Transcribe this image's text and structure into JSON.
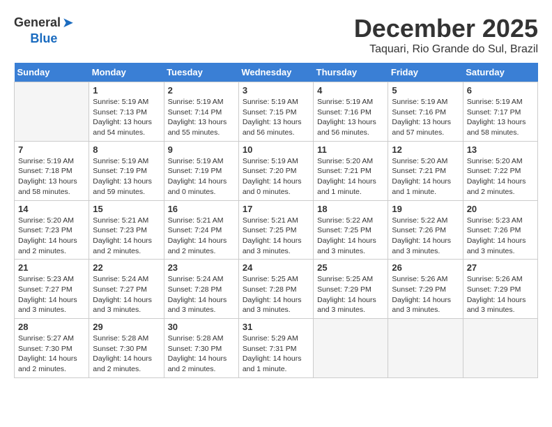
{
  "header": {
    "logo_general": "General",
    "logo_blue": "Blue",
    "month": "December 2025",
    "location": "Taquari, Rio Grande do Sul, Brazil"
  },
  "days_of_week": [
    "Sunday",
    "Monday",
    "Tuesday",
    "Wednesday",
    "Thursday",
    "Friday",
    "Saturday"
  ],
  "weeks": [
    [
      {
        "day": "",
        "empty": true
      },
      {
        "day": "1",
        "sunrise": "Sunrise: 5:19 AM",
        "sunset": "Sunset: 7:13 PM",
        "daylight": "Daylight: 13 hours and 54 minutes."
      },
      {
        "day": "2",
        "sunrise": "Sunrise: 5:19 AM",
        "sunset": "Sunset: 7:14 PM",
        "daylight": "Daylight: 13 hours and 55 minutes."
      },
      {
        "day": "3",
        "sunrise": "Sunrise: 5:19 AM",
        "sunset": "Sunset: 7:15 PM",
        "daylight": "Daylight: 13 hours and 56 minutes."
      },
      {
        "day": "4",
        "sunrise": "Sunrise: 5:19 AM",
        "sunset": "Sunset: 7:16 PM",
        "daylight": "Daylight: 13 hours and 56 minutes."
      },
      {
        "day": "5",
        "sunrise": "Sunrise: 5:19 AM",
        "sunset": "Sunset: 7:16 PM",
        "daylight": "Daylight: 13 hours and 57 minutes."
      },
      {
        "day": "6",
        "sunrise": "Sunrise: 5:19 AM",
        "sunset": "Sunset: 7:17 PM",
        "daylight": "Daylight: 13 hours and 58 minutes."
      }
    ],
    [
      {
        "day": "7",
        "sunrise": "Sunrise: 5:19 AM",
        "sunset": "Sunset: 7:18 PM",
        "daylight": "Daylight: 13 hours and 58 minutes."
      },
      {
        "day": "8",
        "sunrise": "Sunrise: 5:19 AM",
        "sunset": "Sunset: 7:19 PM",
        "daylight": "Daylight: 13 hours and 59 minutes."
      },
      {
        "day": "9",
        "sunrise": "Sunrise: 5:19 AM",
        "sunset": "Sunset: 7:19 PM",
        "daylight": "Daylight: 14 hours and 0 minutes."
      },
      {
        "day": "10",
        "sunrise": "Sunrise: 5:19 AM",
        "sunset": "Sunset: 7:20 PM",
        "daylight": "Daylight: 14 hours and 0 minutes."
      },
      {
        "day": "11",
        "sunrise": "Sunrise: 5:20 AM",
        "sunset": "Sunset: 7:21 PM",
        "daylight": "Daylight: 14 hours and 1 minute."
      },
      {
        "day": "12",
        "sunrise": "Sunrise: 5:20 AM",
        "sunset": "Sunset: 7:21 PM",
        "daylight": "Daylight: 14 hours and 1 minute."
      },
      {
        "day": "13",
        "sunrise": "Sunrise: 5:20 AM",
        "sunset": "Sunset: 7:22 PM",
        "daylight": "Daylight: 14 hours and 2 minutes."
      }
    ],
    [
      {
        "day": "14",
        "sunrise": "Sunrise: 5:20 AM",
        "sunset": "Sunset: 7:23 PM",
        "daylight": "Daylight: 14 hours and 2 minutes."
      },
      {
        "day": "15",
        "sunrise": "Sunrise: 5:21 AM",
        "sunset": "Sunset: 7:23 PM",
        "daylight": "Daylight: 14 hours and 2 minutes."
      },
      {
        "day": "16",
        "sunrise": "Sunrise: 5:21 AM",
        "sunset": "Sunset: 7:24 PM",
        "daylight": "Daylight: 14 hours and 2 minutes."
      },
      {
        "day": "17",
        "sunrise": "Sunrise: 5:21 AM",
        "sunset": "Sunset: 7:25 PM",
        "daylight": "Daylight: 14 hours and 3 minutes."
      },
      {
        "day": "18",
        "sunrise": "Sunrise: 5:22 AM",
        "sunset": "Sunset: 7:25 PM",
        "daylight": "Daylight: 14 hours and 3 minutes."
      },
      {
        "day": "19",
        "sunrise": "Sunrise: 5:22 AM",
        "sunset": "Sunset: 7:26 PM",
        "daylight": "Daylight: 14 hours and 3 minutes."
      },
      {
        "day": "20",
        "sunrise": "Sunrise: 5:23 AM",
        "sunset": "Sunset: 7:26 PM",
        "daylight": "Daylight: 14 hours and 3 minutes."
      }
    ],
    [
      {
        "day": "21",
        "sunrise": "Sunrise: 5:23 AM",
        "sunset": "Sunset: 7:27 PM",
        "daylight": "Daylight: 14 hours and 3 minutes."
      },
      {
        "day": "22",
        "sunrise": "Sunrise: 5:24 AM",
        "sunset": "Sunset: 7:27 PM",
        "daylight": "Daylight: 14 hours and 3 minutes."
      },
      {
        "day": "23",
        "sunrise": "Sunrise: 5:24 AM",
        "sunset": "Sunset: 7:28 PM",
        "daylight": "Daylight: 14 hours and 3 minutes."
      },
      {
        "day": "24",
        "sunrise": "Sunrise: 5:25 AM",
        "sunset": "Sunset: 7:28 PM",
        "daylight": "Daylight: 14 hours and 3 minutes."
      },
      {
        "day": "25",
        "sunrise": "Sunrise: 5:25 AM",
        "sunset": "Sunset: 7:29 PM",
        "daylight": "Daylight: 14 hours and 3 minutes."
      },
      {
        "day": "26",
        "sunrise": "Sunrise: 5:26 AM",
        "sunset": "Sunset: 7:29 PM",
        "daylight": "Daylight: 14 hours and 3 minutes."
      },
      {
        "day": "27",
        "sunrise": "Sunrise: 5:26 AM",
        "sunset": "Sunset: 7:29 PM",
        "daylight": "Daylight: 14 hours and 3 minutes."
      }
    ],
    [
      {
        "day": "28",
        "sunrise": "Sunrise: 5:27 AM",
        "sunset": "Sunset: 7:30 PM",
        "daylight": "Daylight: 14 hours and 2 minutes."
      },
      {
        "day": "29",
        "sunrise": "Sunrise: 5:28 AM",
        "sunset": "Sunset: 7:30 PM",
        "daylight": "Daylight: 14 hours and 2 minutes."
      },
      {
        "day": "30",
        "sunrise": "Sunrise: 5:28 AM",
        "sunset": "Sunset: 7:30 PM",
        "daylight": "Daylight: 14 hours and 2 minutes."
      },
      {
        "day": "31",
        "sunrise": "Sunrise: 5:29 AM",
        "sunset": "Sunset: 7:31 PM",
        "daylight": "Daylight: 14 hours and 1 minute."
      },
      {
        "day": "",
        "empty": true
      },
      {
        "day": "",
        "empty": true
      },
      {
        "day": "",
        "empty": true
      }
    ]
  ]
}
